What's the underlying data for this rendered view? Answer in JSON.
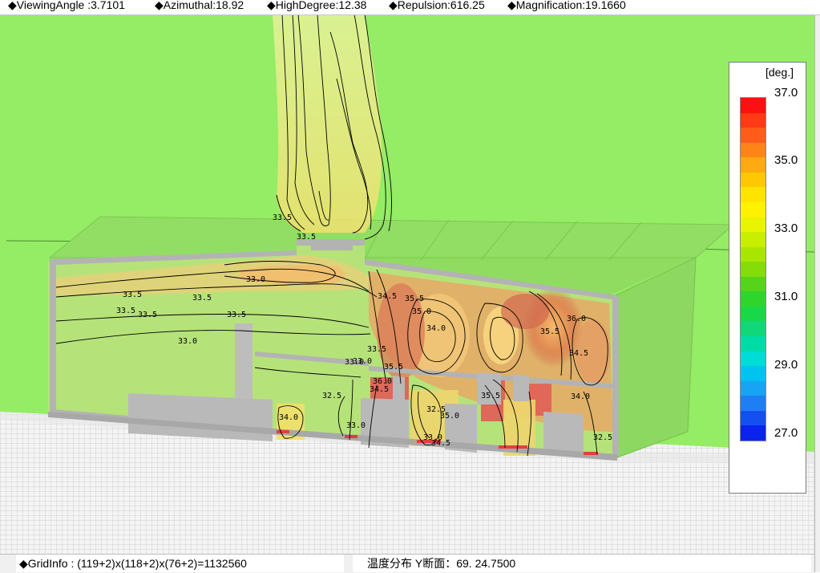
{
  "header": {
    "viewing_angle": "◆ViewingAngle :3.7101",
    "azimuthal": "◆Azimuthal:18.92",
    "high_degree": "◆HighDegree:12.38",
    "repulsion": "◆Repulsion:616.25",
    "magnification": "◆Magnification:19.1660"
  },
  "legend": {
    "unit": "[deg.]",
    "ticks": [
      "37.0",
      "35.0",
      "33.0",
      "31.0",
      "29.0",
      "27.0"
    ],
    "colors": [
      "#ff1010",
      "#ff3a14",
      "#ff5c1a",
      "#ff8418",
      "#ffaa10",
      "#ffc800",
      "#ffe400",
      "#fff200",
      "#e8f400",
      "#c8ee00",
      "#a8e600",
      "#86dc08",
      "#56d41a",
      "#2ed62c",
      "#18d848",
      "#10d878",
      "#00dca8",
      "#00dcd6",
      "#00c4f0",
      "#18a4f4",
      "#1e7ef4",
      "#1450f0",
      "#0a24ee"
    ]
  },
  "contour_labels": [
    "33.5",
    "33.5",
    "33.0",
    "33.5",
    "33.5",
    "33.5",
    "33.5",
    "33.0",
    "34.5",
    "35.5",
    "35.0",
    "34.0",
    "35.5",
    "36.0",
    "34.5",
    "33.5",
    "33.0",
    "35.5",
    "36.0",
    "34.5",
    "32.5",
    "34.0",
    "33.0",
    "32.5",
    "35.0",
    "35.5",
    "33.0",
    "34.5",
    "34.0",
    "32.5",
    "33.5",
    "33.0"
  ],
  "status": {
    "grid_info": "◆GridInfo : (119+2)x(118+2)x(76+2)=1132560",
    "section": "温度分布 Y断面：69. 24.7500"
  }
}
